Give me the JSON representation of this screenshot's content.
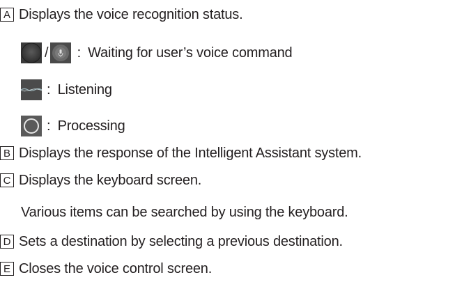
{
  "items": [
    {
      "letter": "A",
      "text": "Displays the voice recognition status."
    },
    {
      "letter": "B",
      "text": "Displays the response of the Intelligent Assistant system."
    },
    {
      "letter": "C",
      "text": "Displays the keyboard screen."
    },
    {
      "letter": "D",
      "text": "Sets a destination by selecting a previous destination."
    },
    {
      "letter": "E",
      "text": "Closes the voice control screen."
    }
  ],
  "status": {
    "waiting": {
      "separator": "/",
      "colon": ":",
      "text": "Waiting for user’s voice command",
      "icons": [
        "dark-circle-icon",
        "microphone-icon"
      ]
    },
    "listening": {
      "colon": ":",
      "text": "Listening",
      "icons": [
        "waveform-icon"
      ]
    },
    "processing": {
      "colon": ":",
      "text": "Processing",
      "icons": [
        "ring-icon"
      ]
    }
  },
  "c_note": "Various items can be searched by using the keyboard."
}
